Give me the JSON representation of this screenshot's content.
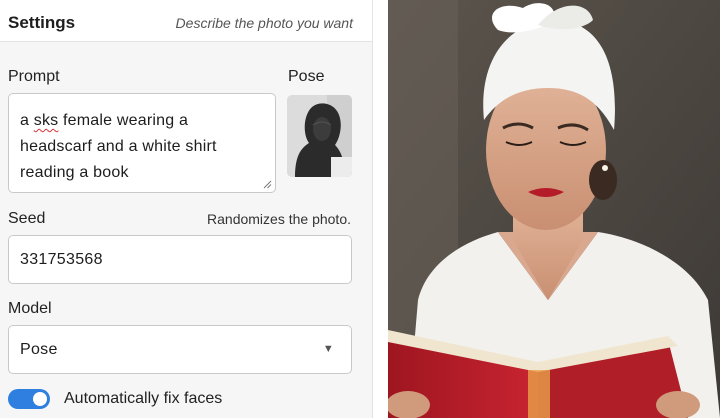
{
  "header": {
    "title": "Settings",
    "hint": "Describe the photo you want"
  },
  "prompt": {
    "label": "Prompt",
    "line1_word": "a ",
    "line1_flagged": "sks",
    "line1_rest": " female wearing a",
    "line2": "headscarf and a white shirt",
    "line3": "reading a book"
  },
  "pose": {
    "label": "Pose",
    "thumbnail_icon": "pose-reference-image"
  },
  "seed": {
    "label": "Seed",
    "hint": "Randomizes the photo.",
    "value": "331753568"
  },
  "model": {
    "label": "Model",
    "selected": "Pose",
    "caret": "▼"
  },
  "faces": {
    "label": "Automatically fix faces",
    "enabled": true
  },
  "colors": {
    "accent": "#2f7fe0",
    "spellcheck": "#d6333a"
  },
  "output": {
    "icon": "generated-photo"
  }
}
